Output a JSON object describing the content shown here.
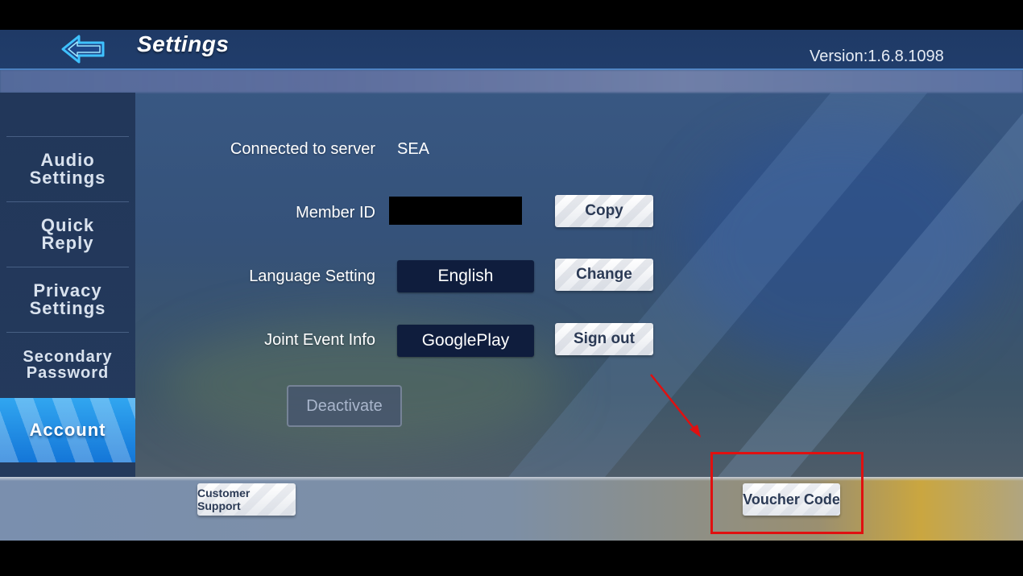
{
  "header": {
    "title": "Settings",
    "version": "Version:1.6.8.1098",
    "back_icon": "back-arrow-icon"
  },
  "sidebar": {
    "items": [
      {
        "line1": "Audio",
        "line2": "Settings"
      },
      {
        "line1": "Quick",
        "line2": "Reply"
      },
      {
        "line1": "Privacy",
        "line2": "Settings"
      },
      {
        "line1": "Secondary",
        "line2": "Password"
      },
      {
        "line1": "Account",
        "line2": ""
      }
    ],
    "active_index": 4
  },
  "account": {
    "server_label": "Connected to server",
    "server_value": "SEA",
    "member_id_label": "Member ID",
    "copy_button": "Copy",
    "language_label": "Language Setting",
    "language_value": "English",
    "change_button": "Change",
    "joint_event_label": "Joint Event Info",
    "joint_event_value": "GooglePlay",
    "sign_out_button": "Sign out",
    "deactivate_button": "Deactivate"
  },
  "footer": {
    "customer_support": "Customer Support",
    "voucher_code": "Voucher Code"
  },
  "colors": {
    "header_bg": "#1f3a66",
    "sidebar_bg": "#22375a",
    "active_tab": "#1e8fe6",
    "dark_field": "#0f1d3d",
    "annotation": "#e01010"
  }
}
